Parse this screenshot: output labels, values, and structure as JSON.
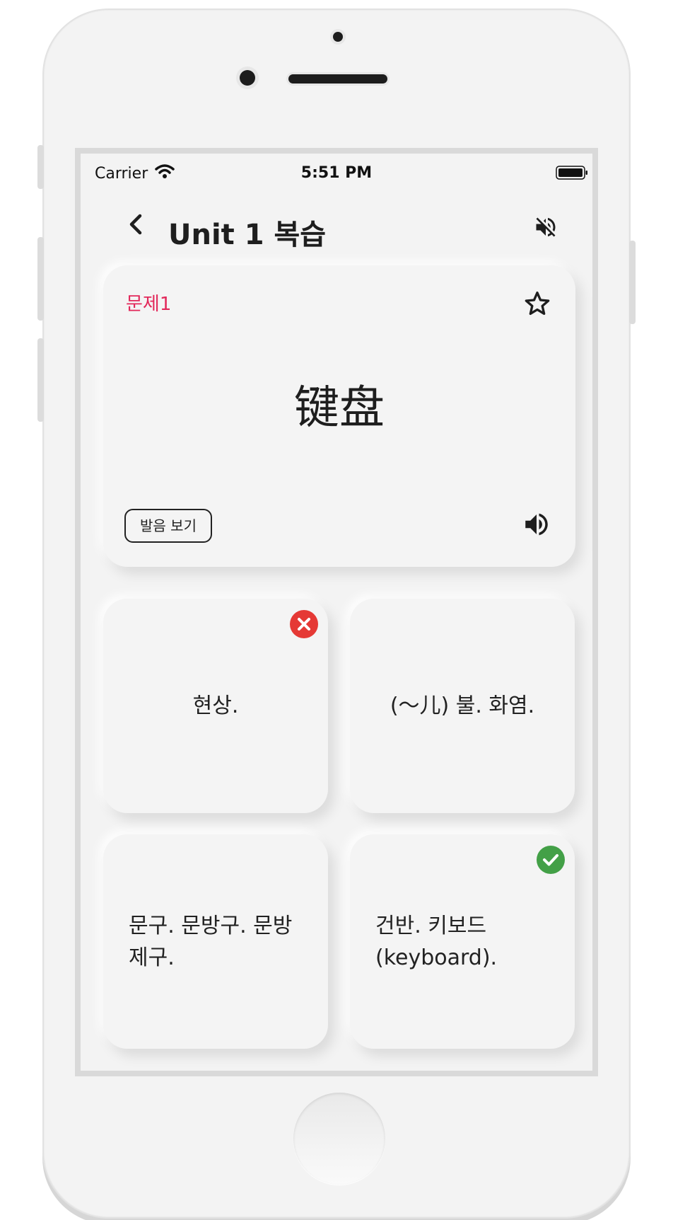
{
  "status_bar": {
    "carrier": "Carrier",
    "time": "5:51 PM"
  },
  "header": {
    "title": "Unit 1 복습"
  },
  "question": {
    "label": "문제1",
    "word": "键盘",
    "pronunciation_button": "발음 보기"
  },
  "answers": [
    {
      "text": "현상.",
      "state": "wrong"
    },
    {
      "text": "(～儿) 불. 화염.",
      "state": "none"
    },
    {
      "text": "문구. 문방구. 문방제구.",
      "state": "none"
    },
    {
      "text": "건반. 키보드(keyboard).",
      "state": "correct"
    }
  ],
  "colors": {
    "accent_label": "#e2285a",
    "wrong_badge": "#e53935",
    "correct_badge": "#43a047",
    "card_bg": "#f4f4f4"
  },
  "icons": [
    "wifi-icon",
    "battery-icon",
    "back-icon",
    "mute-icon",
    "star-icon",
    "speaker-icon",
    "wrong-icon",
    "check-icon"
  ]
}
